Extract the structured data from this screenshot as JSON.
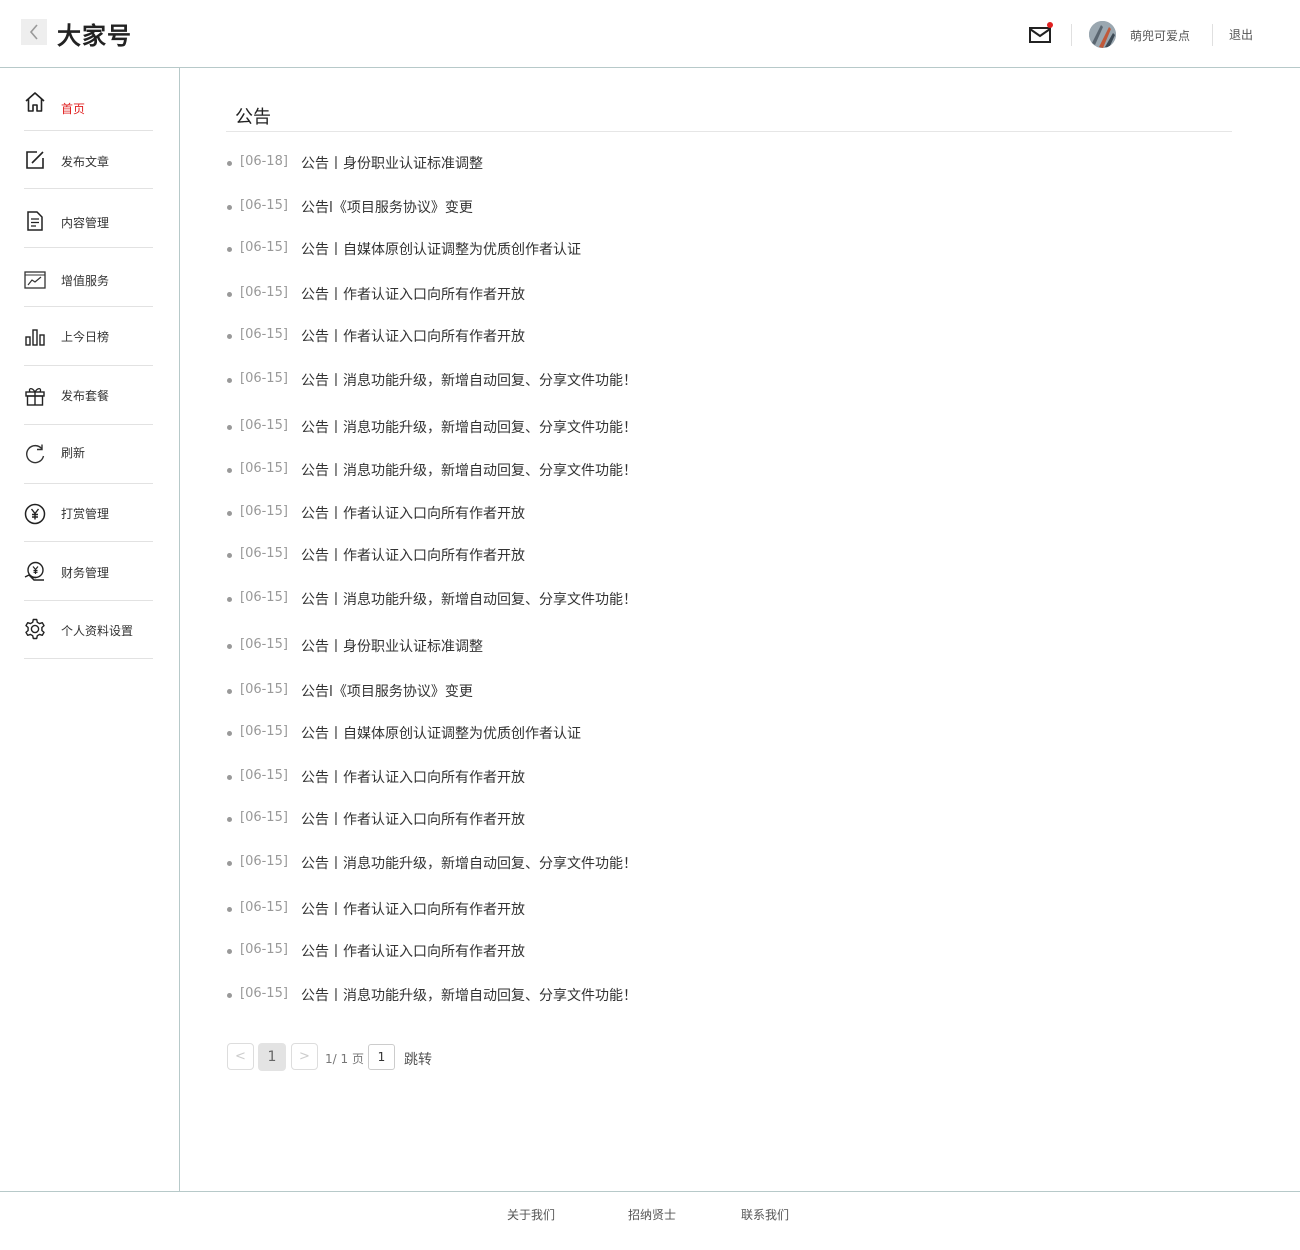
{
  "header": {
    "title": "大家号",
    "username": "萌兜可爱点",
    "logout_label": "退出",
    "has_unread_mail": true
  },
  "sidebar": {
    "items": [
      {
        "label": "首页",
        "icon": "home-icon",
        "active": true
      },
      {
        "label": "发布文章",
        "icon": "edit-icon",
        "active": false
      },
      {
        "label": "内容管理",
        "icon": "document-icon",
        "active": false
      },
      {
        "label": "增值服务",
        "icon": "trend-chart-icon",
        "active": false
      },
      {
        "label": "上今日榜",
        "icon": "bar-chart-icon",
        "active": false
      },
      {
        "label": "发布套餐",
        "icon": "gift-icon",
        "active": false
      },
      {
        "label": "刷新",
        "icon": "refresh-icon",
        "active": false
      },
      {
        "label": "打赏管理",
        "icon": "yen-coin-icon",
        "active": false
      },
      {
        "label": "财务管理",
        "icon": "finance-icon",
        "active": false
      },
      {
        "label": "个人资料设置",
        "icon": "gear-icon",
        "active": false
      }
    ]
  },
  "main": {
    "section_title": "公告",
    "notices": [
      {
        "date": "[06-18]",
        "title": "公告丨身份职业认证标准调整"
      },
      {
        "date": "[06-15]",
        "title": "公告l《项目服务协议》变更"
      },
      {
        "date": "[06-15]",
        "title": "公告丨自媒体原创认证调整为优质创作者认证"
      },
      {
        "date": "[06-15]",
        "title": "公告丨作者认证入口向所有作者开放"
      },
      {
        "date": "[06-15]",
        "title": "公告丨作者认证入口向所有作者开放"
      },
      {
        "date": "[06-15]",
        "title": "公告丨消息功能升级，新增自动回复、分享文件功能！"
      },
      {
        "date": "[06-15]",
        "title": "公告丨消息功能升级，新增自动回复、分享文件功能！"
      },
      {
        "date": "[06-15]",
        "title": "公告丨消息功能升级，新增自动回复、分享文件功能！"
      },
      {
        "date": "[06-15]",
        "title": "公告丨作者认证入口向所有作者开放"
      },
      {
        "date": "[06-15]",
        "title": "公告丨作者认证入口向所有作者开放"
      },
      {
        "date": "[06-15]",
        "title": "公告丨消息功能升级，新增自动回复、分享文件功能！"
      },
      {
        "date": "[06-15]",
        "title": "公告丨身份职业认证标准调整"
      },
      {
        "date": "[06-15]",
        "title": "公告l《项目服务协议》变更"
      },
      {
        "date": "[06-15]",
        "title": "公告丨自媒体原创认证调整为优质创作者认证"
      },
      {
        "date": "[06-15]",
        "title": "公告丨作者认证入口向所有作者开放"
      },
      {
        "date": "[06-15]",
        "title": "公告丨作者认证入口向所有作者开放"
      },
      {
        "date": "[06-15]",
        "title": "公告丨消息功能升级，新增自动回复、分享文件功能！"
      },
      {
        "date": "[06-15]",
        "title": "公告丨作者认证入口向所有作者开放"
      },
      {
        "date": "[06-15]",
        "title": "公告丨作者认证入口向所有作者开放"
      },
      {
        "date": "[06-15]",
        "title": "公告丨消息功能升级，新增自动回复、分享文件功能！"
      }
    ]
  },
  "pagination": {
    "prev_label": "<",
    "current_page": "1",
    "next_label": ">",
    "info": "1/ 1 页",
    "jump_value": "1",
    "jump_label": "跳转"
  },
  "footer": {
    "links": [
      "关于我们",
      "招纳贤士",
      "联系我们"
    ]
  },
  "colors": {
    "accent": "#e02020",
    "divider": "#b7c9c9"
  }
}
